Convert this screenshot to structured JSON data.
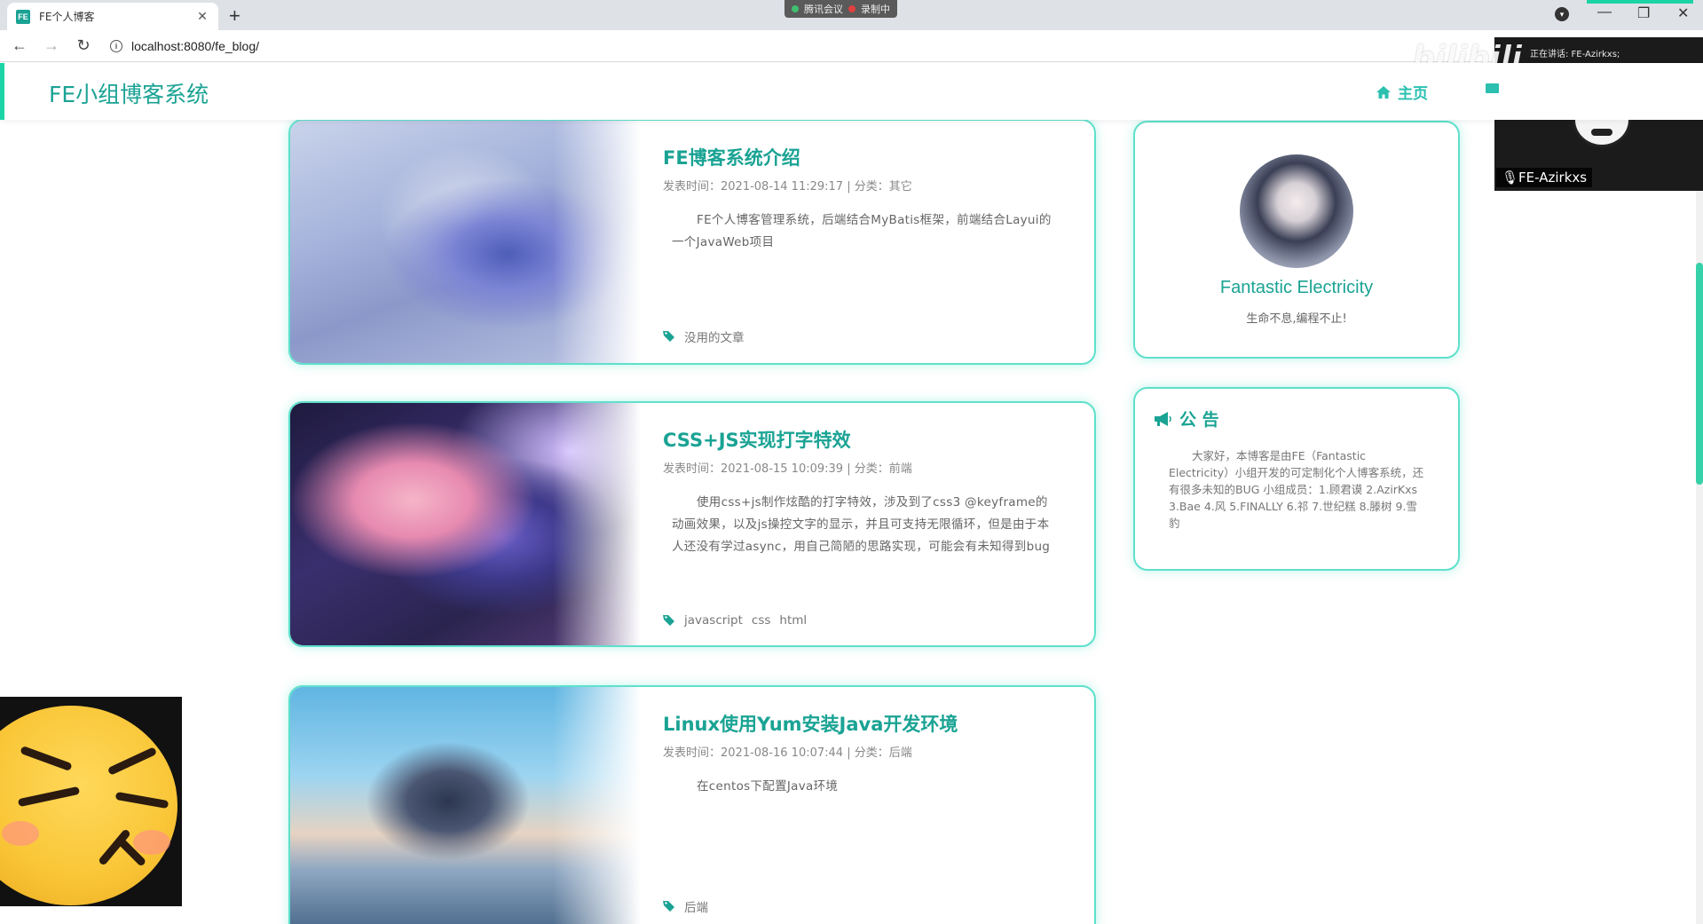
{
  "browser": {
    "tab_title": "FE个人博客",
    "favicon_text": "FE",
    "url": "localhost:8080/fe_blog/",
    "meeting_app": "腾讯会议",
    "recording": "录制中"
  },
  "site": {
    "logo": "FE小组博客系统",
    "nav_home": "主页",
    "accent_color": "#1aa394",
    "border_color": "#5fe0cc"
  },
  "posts": [
    {
      "title": "FE博客系统介绍",
      "meta": "发表时间：2021-08-14 11:29:17 | 分类：其它",
      "desc": "FE个人博客管理系统，后端结合MyBatis框架，前端结合Layui的一个JavaWeb项目",
      "tags": [
        "没用的文章"
      ]
    },
    {
      "title": "CSS+JS实现打字特效",
      "meta": "发表时间：2021-08-15 10:09:39 | 分类：前端",
      "desc": "使用css+js制作炫酷的打字特效，涉及到了css3 @keyframe的动画效果，以及js操控文字的显示，并且可支持无限循环，但是由于本人还没有学过async，用自己简陋的思路实现，可能会有未知得到bug",
      "tags": [
        "javascript",
        "css",
        "html"
      ]
    },
    {
      "title": "Linux使用Yum安装Java开发环境",
      "meta": "发表时间：2021-08-16 10:07:44 | 分类：后端",
      "desc": "在centos下配置Java环境",
      "tags": [
        "后端"
      ]
    }
  ],
  "profile": {
    "name": "Fantastic Electricity",
    "motto": "生命不息,编程不止!"
  },
  "notice": {
    "title": "公 告",
    "text": "大家好，本博客是由FE（Fantastic Electricity）小组开发的可定制化个人博客系统，还有很多未知的BUG 小组成员：1.顾君谟 2.AzirKxs 3.Bae 4.风 5.FINALLY 6.祁 7.世纪糕 8.滕树 9.雪豹"
  },
  "overlay": {
    "speaker_status": "正在讲话: FE-Azirkxs;",
    "camera_name": "FE-Azirkxs",
    "watermark": "bilibili"
  }
}
